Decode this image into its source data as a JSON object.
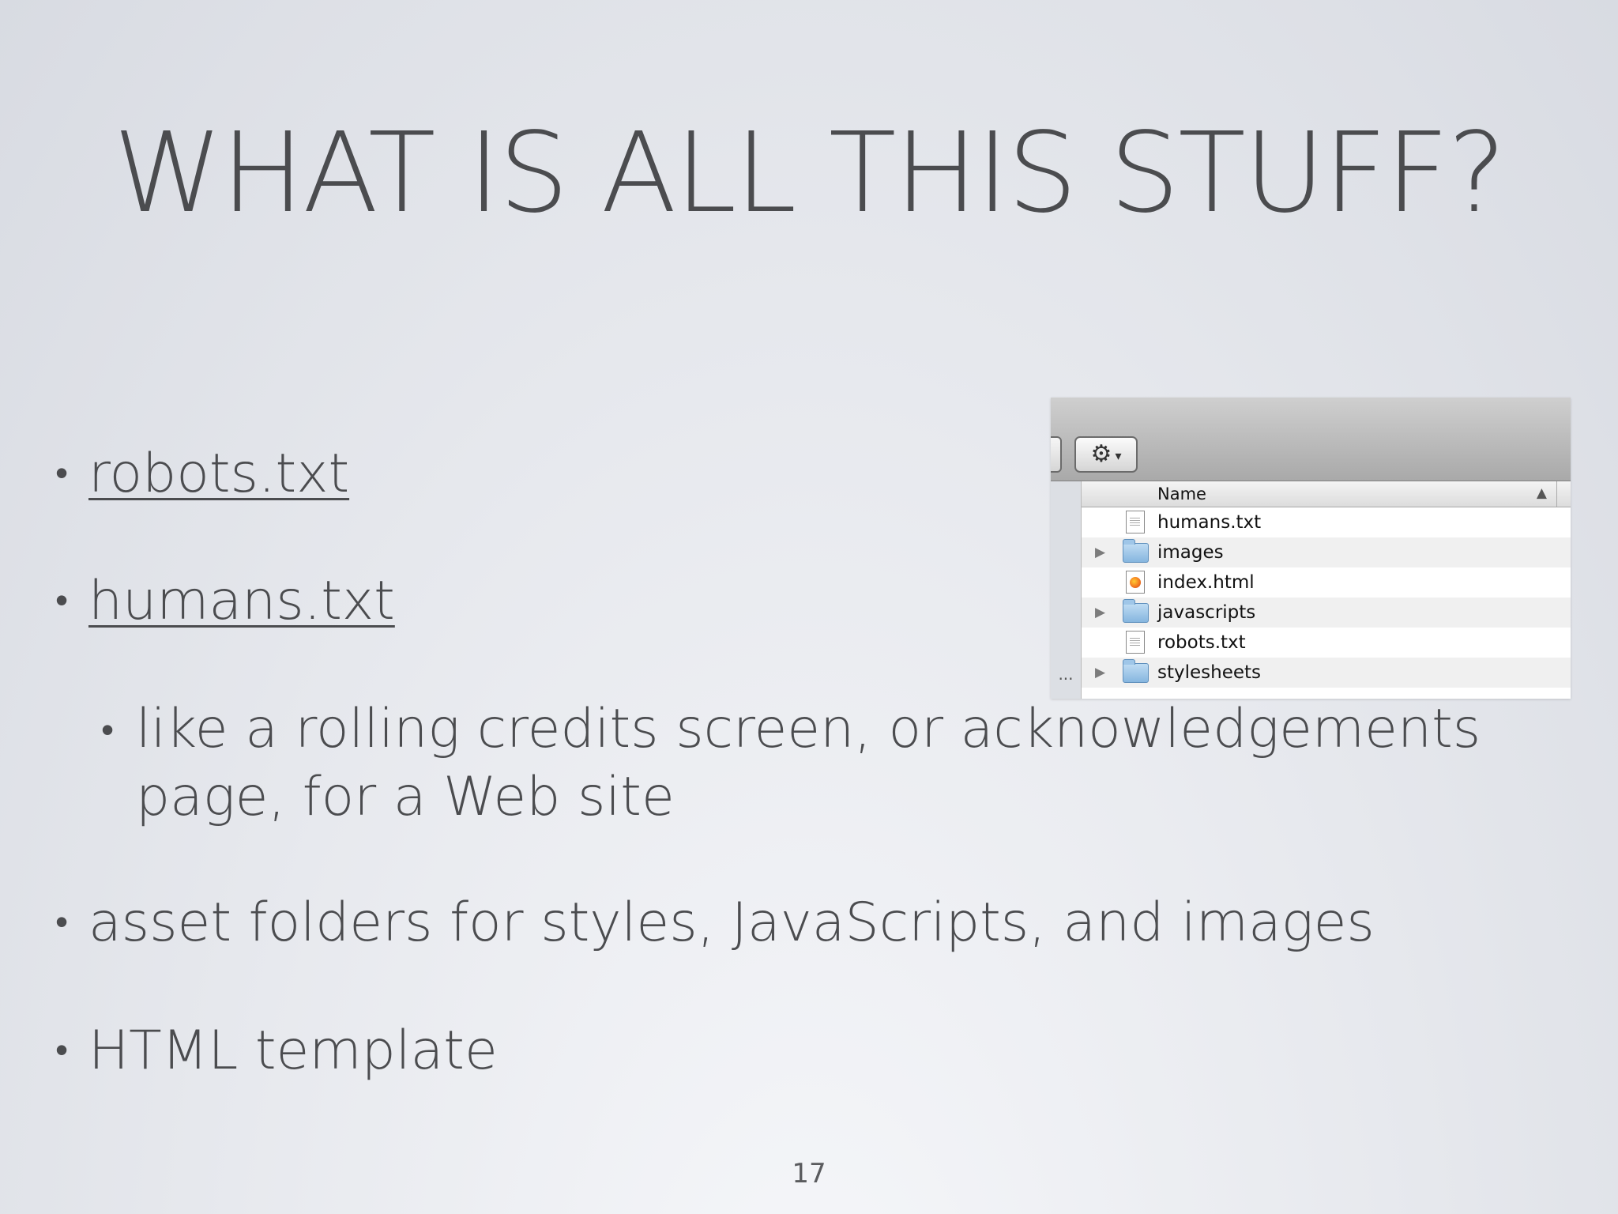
{
  "slide": {
    "title": "WHAT IS ALL THIS STUFF?",
    "bullets": {
      "robots": "robots.txt",
      "humans": "humans.txt",
      "humans_sub": "like a rolling credits screen, or acknowledgements page, for a Web site",
      "assets": "asset folders for styles, JavaScripts, and images",
      "template": "HTML template"
    },
    "bullet_char": "•",
    "page_number": "17"
  },
  "finder": {
    "gear_glyph": "⚙",
    "caret_glyph": "▾",
    "column_header": "Name",
    "sort_arrow": "▲",
    "sidebar_ellipsis": "...",
    "disclosure_glyph": "▶",
    "rows": [
      {
        "label": "humans.txt",
        "kind": "text-file"
      },
      {
        "label": "images",
        "kind": "folder"
      },
      {
        "label": "index.html",
        "kind": "html-file"
      },
      {
        "label": "javascripts",
        "kind": "folder"
      },
      {
        "label": "robots.txt",
        "kind": "text-file"
      },
      {
        "label": "stylesheets",
        "kind": "folder"
      }
    ]
  }
}
